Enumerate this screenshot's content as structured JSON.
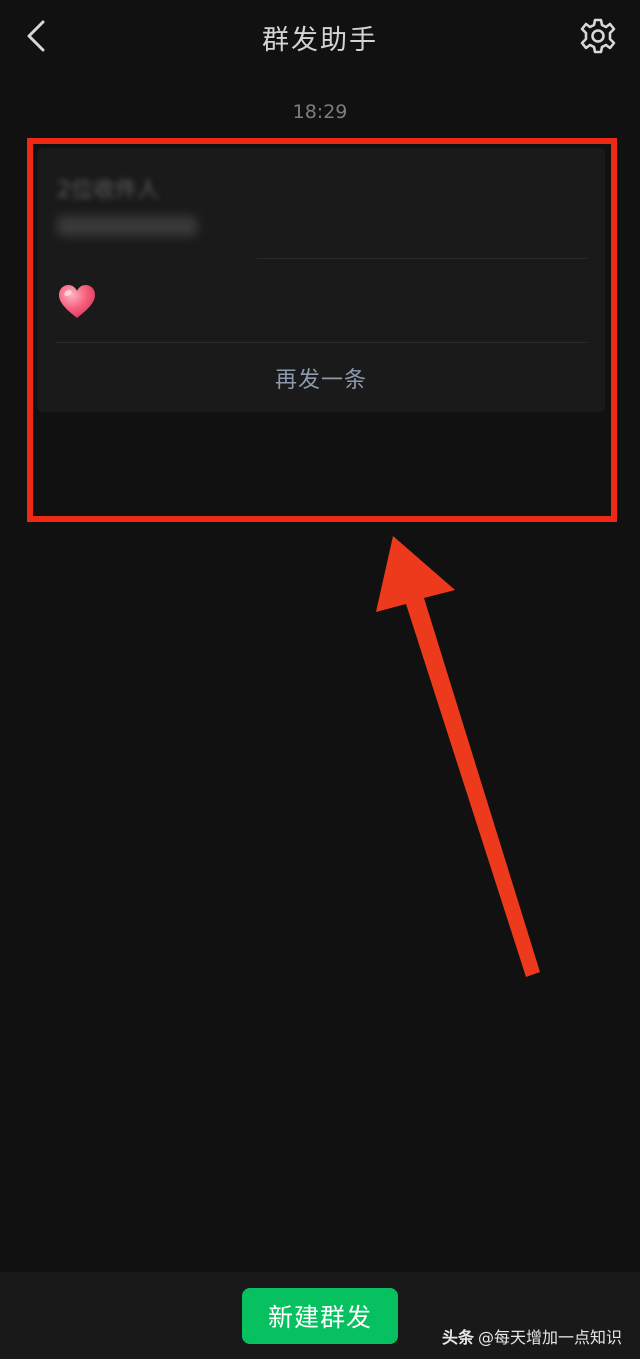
{
  "header": {
    "title": "群发助手",
    "back_icon": "chevron-left-icon",
    "settings_icon": "gear-icon"
  },
  "timestamp": "18:29",
  "message_card": {
    "recipients_label": "2位收件人",
    "emoji": "heart-emoji",
    "resend_label": "再发一条"
  },
  "bottom": {
    "new_button_label": "新建群发"
  },
  "watermark": {
    "brand": "头条",
    "handle": "@每天增加一点知识"
  },
  "colors": {
    "background": "#111111",
    "card": "#1a1a1a",
    "accent_green": "#07c160",
    "annotation_red": "#ee2a17",
    "link_text": "#8f99ad"
  }
}
